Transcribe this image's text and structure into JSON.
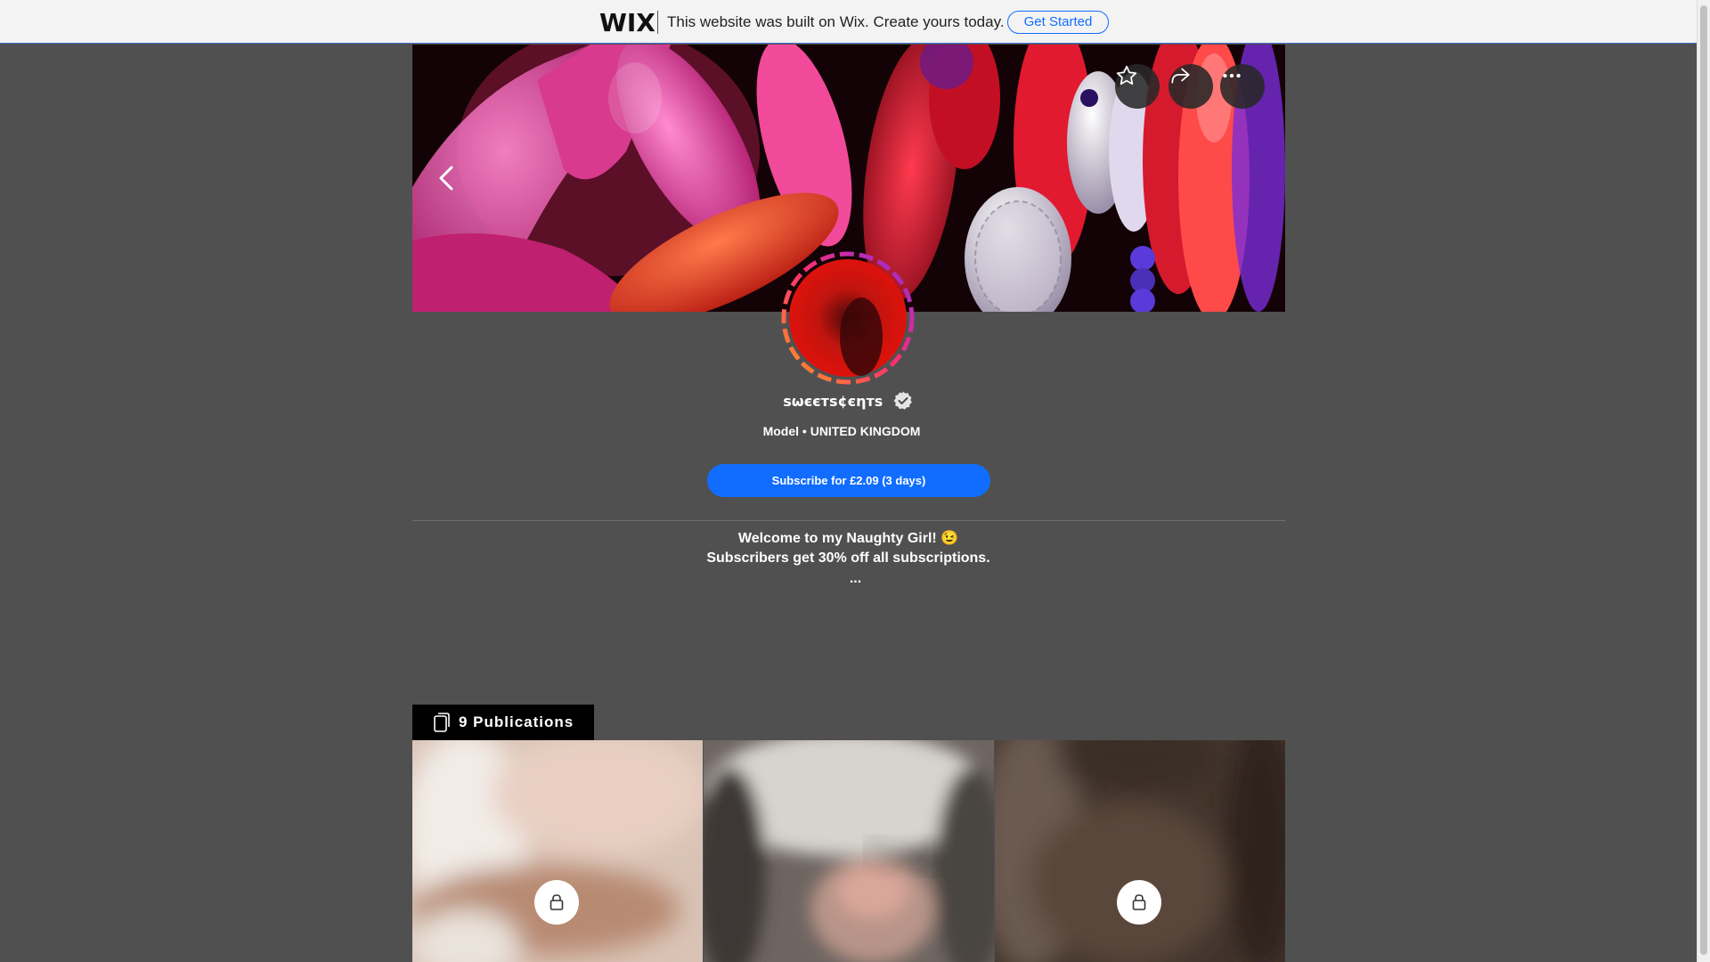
{
  "wix_banner": {
    "logo": "WIX",
    "message": "This website was built on Wix. Create yours today.",
    "cta_label": "Get Started"
  },
  "cover": {
    "back_icon": "chevron-left-icon",
    "actions": [
      {
        "name": "favorite",
        "icon": "star-icon"
      },
      {
        "name": "share",
        "icon": "share-arrow-icon"
      },
      {
        "name": "more",
        "icon": "more-dots-icon"
      }
    ]
  },
  "profile": {
    "display_name": "ѕωєєтѕ¢єηтѕ",
    "verified_icon": "verified-check-icon",
    "subtitle": "Model • UNITED KINGDOM",
    "subscribe_label": "Subscribe for £2.09 (3 days)",
    "accent_color": "#116dff"
  },
  "bio": {
    "line1": "Welcome to my Naughty Girl! 😉",
    "line2": "Subscribers get 30% off all subscriptions.",
    "more": "..."
  },
  "publications": {
    "tab_label": "9 Publications",
    "tab_icon": "copy-pages-icon",
    "tiles": [
      {
        "locked": true
      },
      {
        "locked": false
      },
      {
        "locked": true
      }
    ]
  }
}
